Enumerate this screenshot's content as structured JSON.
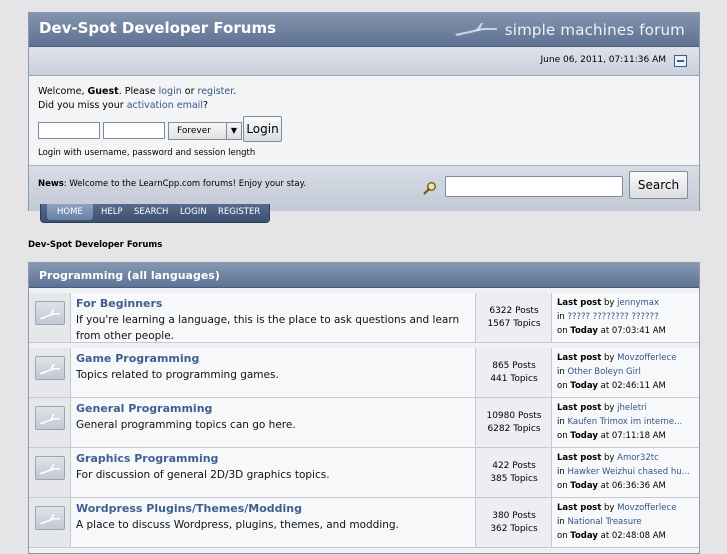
{
  "header": {
    "title": "Dev-Spot Developer Forums",
    "logo_text": "simple machines forum",
    "datetime": "June 06, 2011, 07:11:36 AM"
  },
  "user": {
    "welcome_prefix": "Welcome, ",
    "guest": "Guest",
    "please": ". Please ",
    "login_link": "login",
    "or": " or ",
    "register_link": "register",
    "period": ".",
    "missed_prefix": "Did you miss your ",
    "activation_link": "activation email",
    "missed_suffix": "?",
    "username_value": "",
    "password_value": "",
    "session_length": "Forever",
    "login_button": "Login",
    "login_hint": "Login with username, password and session length"
  },
  "news": {
    "label": "News",
    "text": ": Welcome to the LearnCpp.com forums!  Enjoy your stay.",
    "search_value": "",
    "search_button": "Search"
  },
  "menu": {
    "items": [
      "HOME",
      "HELP",
      "SEARCH",
      "LOGIN",
      "REGISTER"
    ]
  },
  "breadcrumb": "Dev-Spot Developer Forums",
  "category": {
    "title": "Programming (all languages)",
    "boards": [
      {
        "name": "For Beginners",
        "description": "If you're learning a language, this is the place to ask questions and learn from other people.",
        "posts": "6322 Posts",
        "topics": "1567 Topics",
        "last_by": "jennymax",
        "last_in": "????? ???????? ??????",
        "last_on": "Today",
        "last_at": " at 07:03:41 AM"
      },
      {
        "name": "Game Programming",
        "description": "Topics related to programming games.",
        "posts": "865 Posts",
        "topics": "441 Topics",
        "last_by": "Movzofferlece",
        "last_in": "Other Boleyn Girl",
        "last_on": "Today",
        "last_at": " at 02:46:11 AM"
      },
      {
        "name": "General Programming",
        "description": "General programming topics can go here.",
        "posts": "10980 Posts",
        "topics": "6282 Topics",
        "last_by": "jheletri",
        "last_in": "Kaufen Trimox im interne...",
        "last_on": "Today",
        "last_at": " at 07:11:18 AM"
      },
      {
        "name": "Graphics Programming",
        "description": "For discussion of general 2D/3D graphics topics.",
        "posts": "422 Posts",
        "topics": "385 Topics",
        "last_by": "Amor32tc",
        "last_in": "Hawker Weizhui chased hu...",
        "last_on": "Today",
        "last_at": " at 06:36:36 AM"
      },
      {
        "name": "Wordpress Plugins/Themes/Modding",
        "description": "A place to discuss Wordpress, plugins, themes, and modding.",
        "posts": "380 Posts",
        "topics": "362 Topics",
        "last_by": "Movzofferlece",
        "last_in": "National Treasure",
        "last_on": "Today",
        "last_at": " at 02:48:08 AM"
      }
    ],
    "last_post_label": "Last post",
    "by_label": " by ",
    "in_label": "in ",
    "on_label": "on "
  }
}
